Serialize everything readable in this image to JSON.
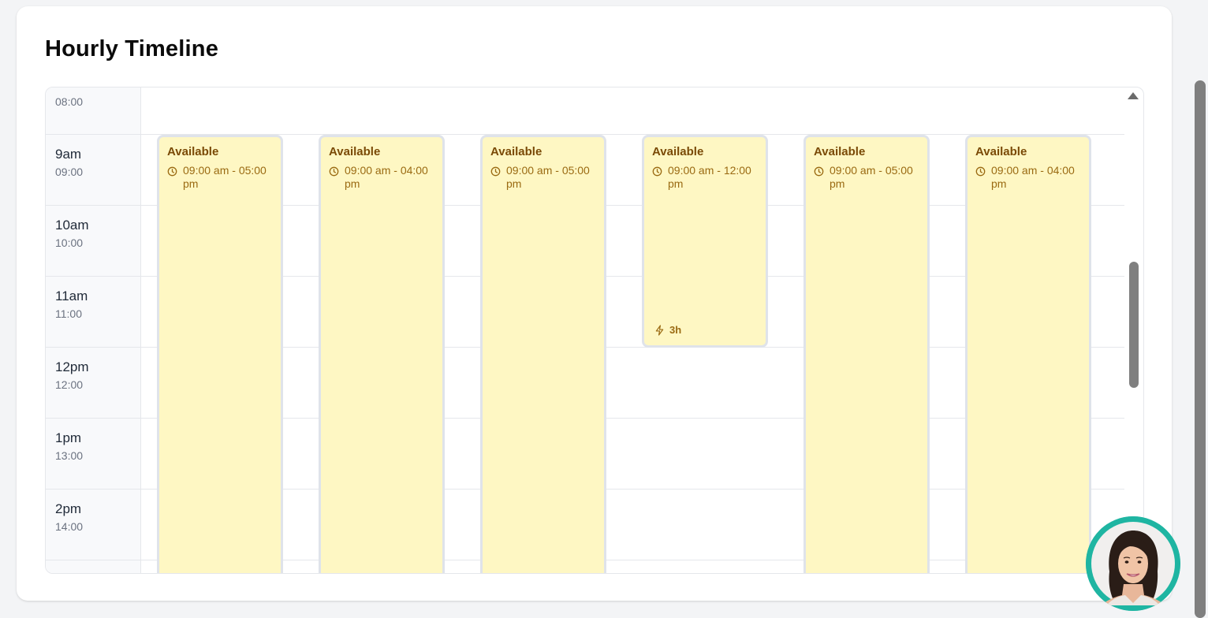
{
  "title": "Hourly Timeline",
  "hours": [
    {
      "label": "",
      "sub": "08:00"
    },
    {
      "label": "9am",
      "sub": "09:00"
    },
    {
      "label": "10am",
      "sub": "10:00"
    },
    {
      "label": "11am",
      "sub": "11:00"
    },
    {
      "label": "12pm",
      "sub": "12:00"
    },
    {
      "label": "1pm",
      "sub": "13:00"
    },
    {
      "label": "2pm",
      "sub": "14:00"
    }
  ],
  "blocks": [
    {
      "title": "Available",
      "time": "09:00 am - 05:00 pm",
      "duration": ""
    },
    {
      "title": "Available",
      "time": "09:00 am - 04:00 pm",
      "duration": ""
    },
    {
      "title": "Available",
      "time": "09:00 am - 05:00 pm",
      "duration": ""
    },
    {
      "title": "Available",
      "time": "09:00 am - 12:00 pm",
      "duration": "3h"
    },
    {
      "title": "Available",
      "time": "09:00 am - 05:00 pm",
      "duration": ""
    },
    {
      "title": "Available",
      "time": "09:00 am - 04:00 pm",
      "duration": ""
    }
  ],
  "colors": {
    "block_bg": "#fef7c3",
    "block_title": "#7a4a06",
    "block_text": "#9a6a12",
    "avatar_ring": "#1fb5a2"
  },
  "icons": {
    "clock": "clock-icon",
    "bolt": "bolt-icon",
    "avatar": "assistant-avatar"
  }
}
